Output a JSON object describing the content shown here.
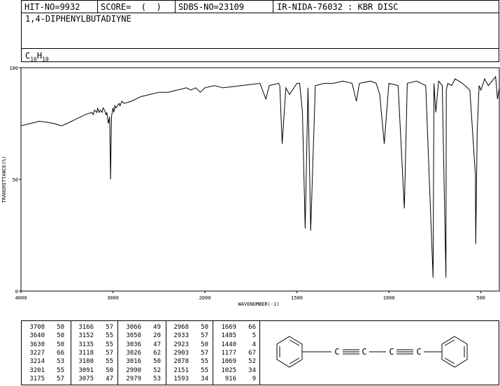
{
  "header": {
    "hit_no": "HIT-NO=9932",
    "score": "SCORE=  (  )",
    "sdbs_no": "SDBS-NO=23109",
    "ir_nida": "IR-NIDA-76032 : KBR DISC"
  },
  "compound": {
    "name": "1,4-DIPHENYLBUTADIYNE",
    "formula_c": "C",
    "formula_c_sub": "16",
    "formula_h": "H",
    "formula_h_sub": "10"
  },
  "chart_data": {
    "type": "line",
    "xlabel": "WAVENUMBER(-1)",
    "ylabel": "TRANSMITTANCE(%)",
    "xlim": [
      4000,
      400
    ],
    "ylim": [
      0,
      100
    ],
    "x_ticks": [
      "4000",
      "3000",
      "2000",
      "1500",
      "1000",
      "500"
    ],
    "x_tick_values": [
      4000,
      3000,
      2000,
      1500,
      1000,
      500
    ],
    "y_ticks": [
      "0",
      "50",
      "100"
    ],
    "y_tick_values": [
      0,
      50,
      100
    ],
    "series": [
      {
        "x": [
          4000,
          3900,
          3800,
          3708,
          3640,
          3560,
          3500,
          3400,
          3300,
          3230,
          3215,
          3201,
          3175,
          3166,
          3152,
          3135,
          3118,
          3108,
          3091,
          3075,
          3066,
          3050,
          3036,
          3026,
          3016,
          3000,
          2990,
          2979,
          2968,
          2933,
          2923,
          2903,
          2878,
          2800,
          2700,
          2600,
          2500,
          2400,
          2300,
          2200,
          2151,
          2100,
          2050,
          2000,
          1950,
          1900,
          1800,
          1700,
          1669,
          1650,
          1600,
          1593,
          1580,
          1560,
          1540,
          1500,
          1485,
          1470,
          1455,
          1440,
          1425,
          1400,
          1350,
          1300,
          1250,
          1200,
          1177,
          1160,
          1100,
          1069,
          1050,
          1025,
          1000,
          950,
          916,
          900,
          850,
          800,
          760,
          755,
          745,
          730,
          710,
          690,
          688,
          680,
          660,
          640,
          600,
          560,
          530,
          528,
          520,
          510,
          500,
          480,
          460,
          440,
          420,
          410,
          400
        ],
        "y": [
          74,
          75,
          76,
          75.5,
          75,
          74,
          75,
          77,
          79,
          80,
          79,
          81,
          80,
          82,
          80,
          81,
          80,
          82,
          81,
          79,
          80,
          75,
          78,
          50,
          78,
          82,
          80,
          83,
          82,
          84,
          83,
          85,
          84,
          85,
          87,
          88,
          89,
          89,
          90,
          91,
          90,
          91,
          89,
          91,
          92,
          91,
          92,
          93,
          86,
          92,
          93,
          92,
          66,
          91,
          88,
          93,
          93,
          80,
          28,
          91,
          27,
          92,
          93,
          93,
          94,
          93,
          85,
          93,
          94,
          93,
          88,
          66,
          93,
          92,
          37,
          93,
          94,
          92,
          6,
          93,
          80,
          94,
          92,
          6,
          90,
          93,
          92,
          95,
          93,
          90,
          52,
          21,
          72,
          92,
          90,
          95,
          92,
          94,
          96,
          86,
          91
        ]
      }
    ],
    "grid": false
  },
  "peak_table": {
    "columns": [
      [
        [
          "3708",
          "50"
        ],
        [
          "3640",
          "50"
        ],
        [
          "3630",
          "50"
        ],
        [
          "3227",
          "66"
        ],
        [
          "3214",
          "53"
        ],
        [
          "3201",
          "55"
        ],
        [
          "3175",
          "57"
        ]
      ],
      [
        [
          "3166",
          "57"
        ],
        [
          "3152",
          "55"
        ],
        [
          "3135",
          "55"
        ],
        [
          "3118",
          "57"
        ],
        [
          "3108",
          "55"
        ],
        [
          "3091",
          "50"
        ],
        [
          "3075",
          "47"
        ]
      ],
      [
        [
          "3066",
          "49"
        ],
        [
          "3050",
          "20"
        ],
        [
          "3036",
          "47"
        ],
        [
          "3026",
          "62"
        ],
        [
          "3016",
          "50"
        ],
        [
          "2990",
          "52"
        ],
        [
          "2979",
          "53"
        ]
      ],
      [
        [
          "2968",
          "50"
        ],
        [
          "2933",
          "57"
        ],
        [
          "2923",
          "50"
        ],
        [
          "2903",
          "57"
        ],
        [
          "2878",
          "55"
        ],
        [
          "2151",
          "55"
        ],
        [
          "1593",
          "34"
        ]
      ],
      [
        [
          "1669",
          "66"
        ],
        [
          "1485",
          "5"
        ],
        [
          "1440",
          "4"
        ],
        [
          "1177",
          "67"
        ],
        [
          "1069",
          "52"
        ],
        [
          "1025",
          "34"
        ],
        [
          "916",
          "9"
        ]
      ]
    ]
  },
  "structure": {
    "left_atom": "C",
    "atom2": "C",
    "atom3": "C",
    "right_atom": "C"
  }
}
